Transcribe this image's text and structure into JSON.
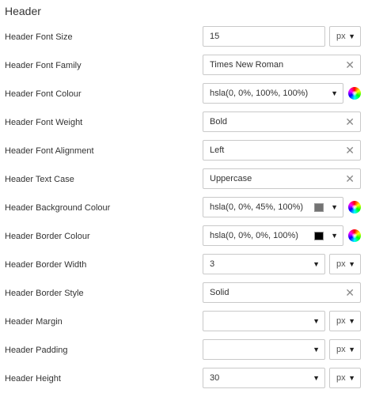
{
  "section": {
    "title": "Header"
  },
  "rows": {
    "font_size": {
      "label": "Header Font Size",
      "value": "15",
      "unit": "px"
    },
    "font_family": {
      "label": "Header Font Family",
      "value": "Times New Roman"
    },
    "font_colour": {
      "label": "Header Font Colour",
      "value": "hsla(0, 0%, 100%, 100%)",
      "swatch": "#ffffff"
    },
    "font_weight": {
      "label": "Header Font Weight",
      "value": "Bold"
    },
    "font_alignment": {
      "label": "Header Font Alignment",
      "value": "Left"
    },
    "text_case": {
      "label": "Header Text Case",
      "value": "Uppercase"
    },
    "background_colour": {
      "label": "Header Background Colour",
      "value": "hsla(0, 0%, 45%, 100%)",
      "swatch": "#737373"
    },
    "border_colour": {
      "label": "Header Border Colour",
      "value": "hsla(0, 0%, 0%, 100%)",
      "swatch": "#000000"
    },
    "border_width": {
      "label": "Header Border Width",
      "value": "3",
      "unit": "px"
    },
    "border_style": {
      "label": "Header Border Style",
      "value": "Solid"
    },
    "margin": {
      "label": "Header Margin",
      "value": "",
      "unit": "px"
    },
    "padding": {
      "label": "Header Padding",
      "value": "",
      "unit": "px"
    },
    "height": {
      "label": "Header Height",
      "value": "30",
      "unit": "px"
    }
  },
  "icons": {
    "caret": "▼",
    "clear": "✕",
    "color_wheel": "color-wheel-icon"
  }
}
